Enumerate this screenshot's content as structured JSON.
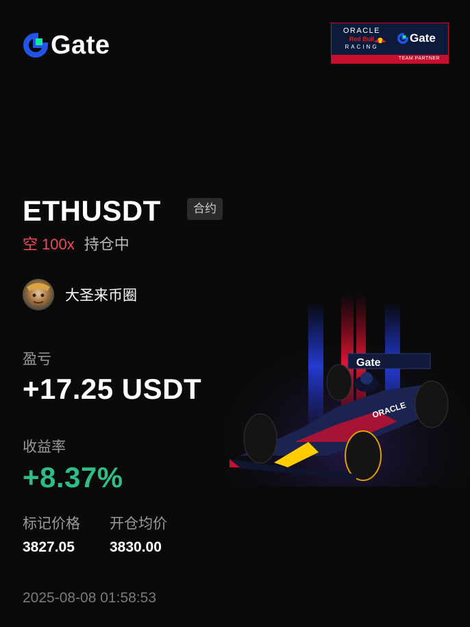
{
  "brand": {
    "name": "Gate"
  },
  "partner": {
    "line1": "ORACLE",
    "line2": "Red Bull",
    "line3": "RACING",
    "brand": "Gate",
    "badge": "TEAM PARTNER"
  },
  "position": {
    "pair": "ETHUSDT",
    "type_tag": "合约",
    "direction": "空",
    "leverage": "100x",
    "status": "持仓中"
  },
  "user": {
    "name": "大圣来币圈"
  },
  "pnl": {
    "label": "盈亏",
    "value": "+17.25 USDT"
  },
  "roi": {
    "label": "收益率",
    "value": "+8.37%"
  },
  "prices": {
    "mark_label": "标记价格",
    "mark_value": "3827.05",
    "entry_label": "开仓均价",
    "entry_value": "3830.00"
  },
  "timestamp": "2025-08-08 01:58:53",
  "colors": {
    "background": "#0a0a0a",
    "brand_blue": "#2354e6",
    "brand_green": "#17e6a1",
    "short_red": "#f04a5a",
    "profit_green": "#2ebd85",
    "partner_navy": "#0d1b3a",
    "partner_red": "#c8102e"
  },
  "icons": {
    "logo": "gate-logo-icon",
    "bull": "red-bull-icon",
    "car": "f1-car-illustration"
  }
}
